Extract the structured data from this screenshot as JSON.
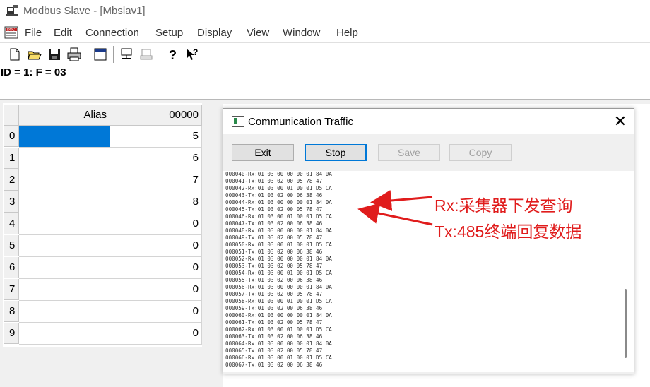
{
  "window": {
    "title": "Modbus Slave - [Mbslav1]"
  },
  "menu": [
    {
      "label": "File",
      "mnemonic": "F",
      "rest": "ile"
    },
    {
      "label": "Edit",
      "mnemonic": "E",
      "rest": "dit"
    },
    {
      "label": "Connection",
      "mnemonic": "C",
      "rest": "onnection"
    },
    {
      "label": "Setup",
      "mnemonic": "S",
      "rest": "etup"
    },
    {
      "label": "Display",
      "mnemonic": "D",
      "rest": "isplay"
    },
    {
      "label": "View",
      "mnemonic": "V",
      "rest": "iew"
    },
    {
      "label": "Window",
      "mnemonic": "W",
      "rest": "indow"
    },
    {
      "label": "Help",
      "mnemonic": "H",
      "rest": "elp"
    }
  ],
  "toolbar": [
    "new-icon",
    "open-icon",
    "save-icon",
    "print-icon",
    "window-icon",
    "connect-icon",
    "disconnect-icon",
    "help-icon",
    "context-help-icon"
  ],
  "slave_header": "ID = 1: F = 03",
  "grid": {
    "col_alias": "Alias",
    "col_value": "00000",
    "rows": [
      {
        "index": "0",
        "value": "5"
      },
      {
        "index": "1",
        "value": "6"
      },
      {
        "index": "2",
        "value": "7"
      },
      {
        "index": "3",
        "value": "8"
      },
      {
        "index": "4",
        "value": "0"
      },
      {
        "index": "5",
        "value": "0"
      },
      {
        "index": "6",
        "value": "0"
      },
      {
        "index": "7",
        "value": "0"
      },
      {
        "index": "8",
        "value": "0"
      },
      {
        "index": "9",
        "value": "0"
      }
    ]
  },
  "dialog": {
    "title": "Communication Traffic",
    "buttons": {
      "exit": {
        "label": "Exit",
        "mnemonic": "x"
      },
      "stop": {
        "label": "Stop",
        "mnemonic": "S"
      },
      "save": {
        "label": "Save",
        "mnemonic": "a"
      },
      "copy": {
        "label": "Copy",
        "mnemonic": "C"
      }
    },
    "traffic_lines": [
      "000040-Rx:01 03 00 00 00 01 84 0A",
      "000041-Tx:01 03 02 00 05 78 47",
      "000042-Rx:01 03 00 01 00 01 D5 CA",
      "000043-Tx:01 03 02 00 06 38 46",
      "000044-Rx:01 03 00 00 00 01 84 0A",
      "000045-Tx:01 03 02 00 05 78 47",
      "000046-Rx:01 03 00 01 00 01 D5 CA",
      "000047-Tx:01 03 02 00 06 38 46",
      "000048-Rx:01 03 00 00 00 01 84 0A",
      "000049-Tx:01 03 02 00 05 78 47",
      "000050-Rx:01 03 00 01 00 01 D5 CA",
      "000051-Tx:01 03 02 00 06 38 46",
      "000052-Rx:01 03 00 00 00 01 84 0A",
      "000053-Tx:01 03 02 00 05 78 47",
      "000054-Rx:01 03 00 01 00 01 D5 CA",
      "000055-Tx:01 03 02 00 06 38 46",
      "000056-Rx:01 03 00 00 00 01 84 0A",
      "000057-Tx:01 03 02 00 05 78 47",
      "000058-Rx:01 03 00 01 00 01 D5 CA",
      "000059-Tx:01 03 02 00 06 38 46",
      "000060-Rx:01 03 00 00 00 01 84 0A",
      "000061-Tx:01 03 02 00 05 78 47",
      "000062-Rx:01 03 00 01 00 01 D5 CA",
      "000063-Tx:01 03 02 00 06 38 46",
      "000064-Rx:01 03 00 00 00 01 84 0A",
      "000065-Tx:01 03 02 00 05 78 47",
      "000066-Rx:01 03 00 01 00 01 D5 CA",
      "000067-Tx:01 03 02 00 06 38 46"
    ]
  },
  "annotations": {
    "rx": "Rx:采集器下发查询",
    "tx": "Tx:485终端回复数据",
    "color": "#e01c1c"
  },
  "colors": {
    "selection": "#0078d7"
  }
}
